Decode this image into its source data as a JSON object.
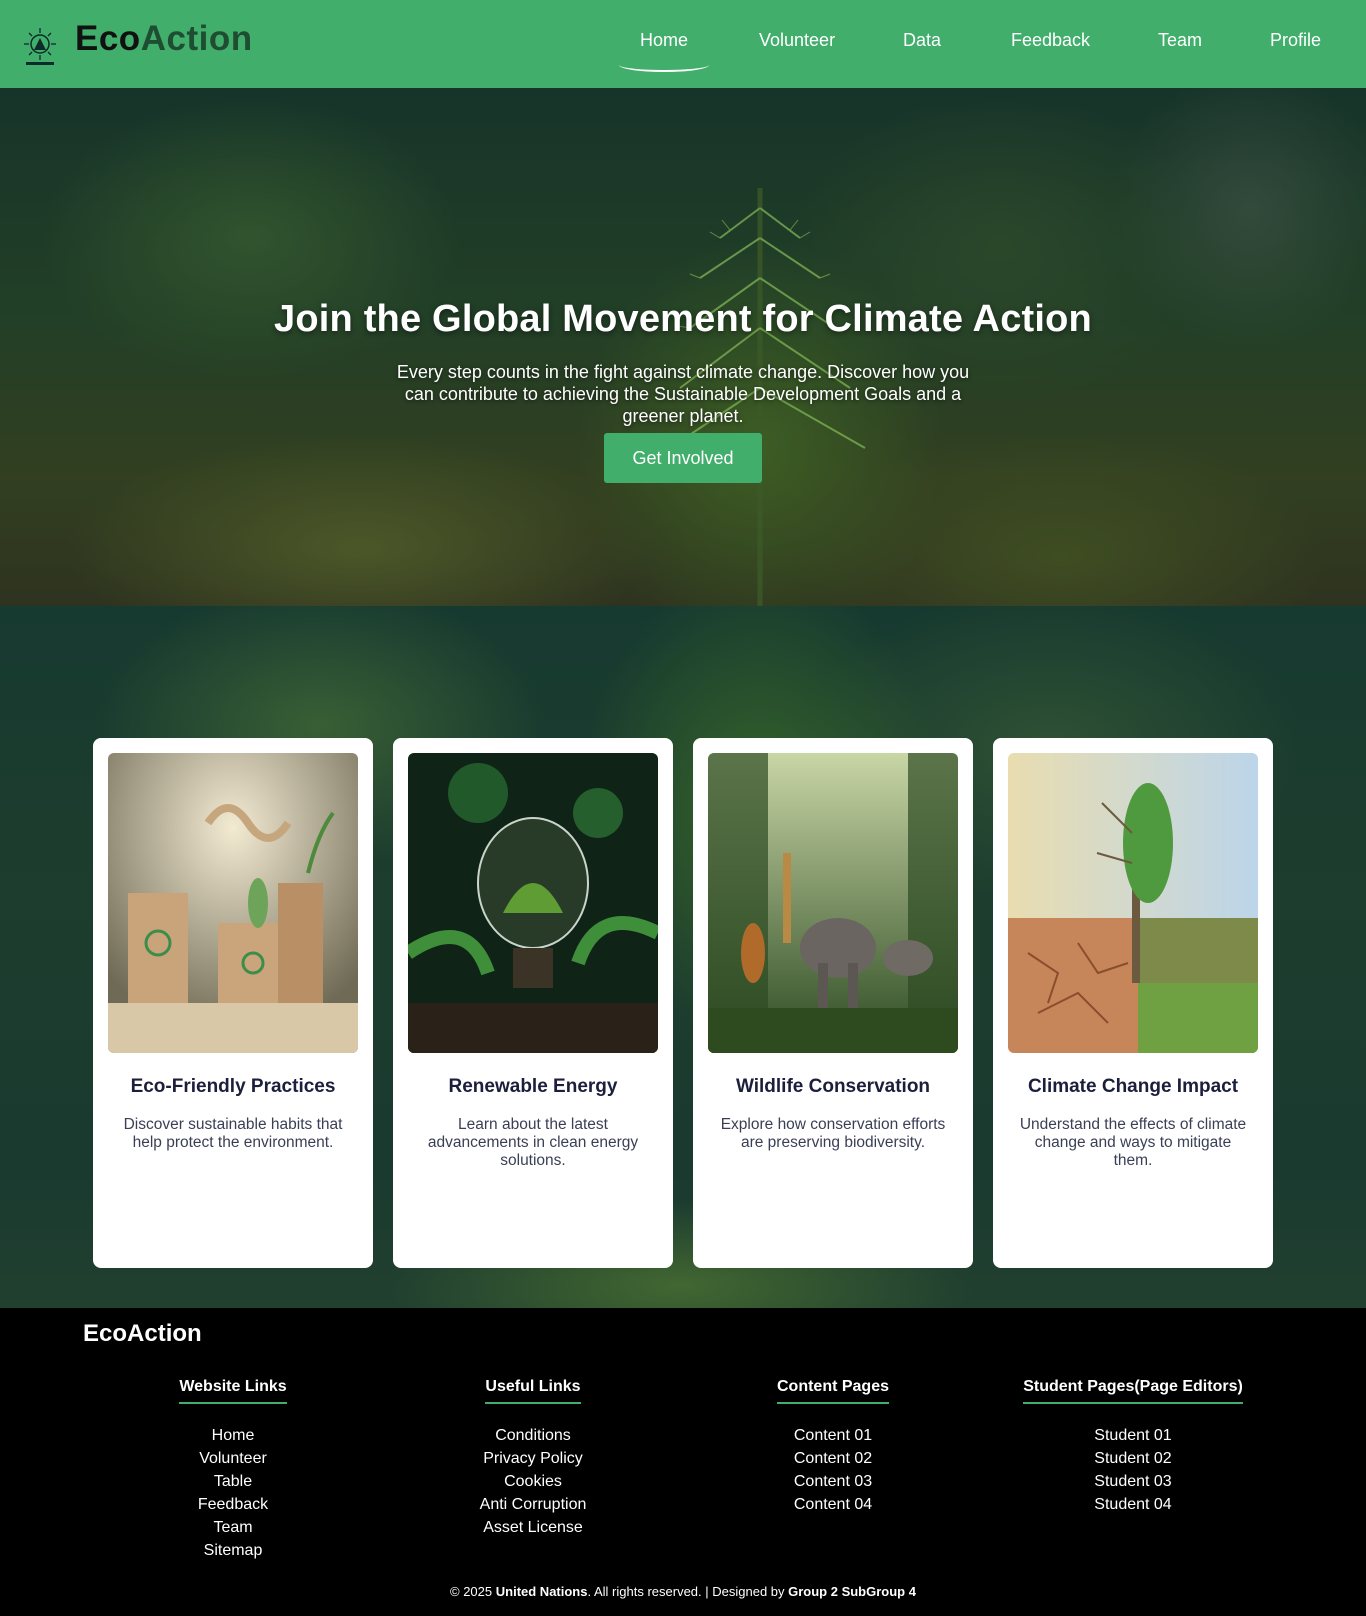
{
  "header": {
    "brand_eco": "Eco",
    "brand_action": "Action",
    "nav": [
      {
        "label": "Home",
        "active": true
      },
      {
        "label": "Volunteer"
      },
      {
        "label": "Data"
      },
      {
        "label": "Feedback"
      },
      {
        "label": "Team"
      },
      {
        "label": "Profile"
      }
    ],
    "accent_color": "#41ae6c"
  },
  "hero": {
    "title": "Join the Global Movement for Climate Action",
    "subtitle": "Every step counts in the fight against climate change. Discover how you can contribute to achieving the Sustainable Development Goals and a greener planet.",
    "cta_label": "Get Involved"
  },
  "cards": [
    {
      "title": "Eco-Friendly Practices",
      "desc": "Discover sustainable habits that help protect the environment.",
      "image_icon": "recycling-products-image"
    },
    {
      "title": "Renewable Energy",
      "desc": "Learn about the latest advancements in clean energy solutions.",
      "image_icon": "lightbulb-plant-image"
    },
    {
      "title": "Wildlife Conservation",
      "desc": "Explore how conservation efforts are preserving biodiversity.",
      "image_icon": "jungle-animals-image"
    },
    {
      "title": "Climate Change Impact",
      "desc": "Understand the effects of climate change and ways to mitigate them.",
      "image_icon": "dry-vs-green-land-image"
    }
  ],
  "footer": {
    "brand": "EcoAction",
    "columns": [
      {
        "heading": "Website Links",
        "links": [
          "Home",
          "Volunteer",
          "Table",
          "Feedback",
          "Team",
          "Sitemap"
        ]
      },
      {
        "heading": "Useful Links",
        "links": [
          "Conditions",
          "Privacy Policy",
          "Cookies",
          "Anti Corruption",
          "Asset License"
        ]
      },
      {
        "heading": "Content Pages",
        "links": [
          "Content 01",
          "Content 02",
          "Content 03",
          "Content 04"
        ]
      },
      {
        "heading": "Student Pages(Page Editors)",
        "links": [
          "Student 01",
          "Student 02",
          "Student 03",
          "Student 04"
        ]
      }
    ],
    "copyright_prefix": "© 2025 ",
    "copyright_org": "United Nations",
    "copyright_mid": ". All rights reserved. | Designed by ",
    "copyright_designer": "Group 2 SubGroup 4"
  }
}
